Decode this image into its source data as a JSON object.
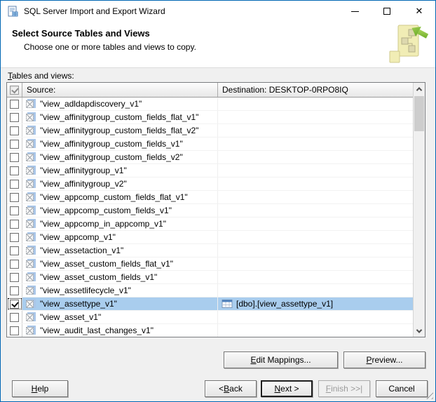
{
  "window": {
    "title": "SQL Server Import and Export Wizard"
  },
  "header": {
    "title": "Select Source Tables and Views",
    "subtitle": "Choose one or more tables and views to copy."
  },
  "tables_label": {
    "label": "Tables and views:",
    "accel": "T"
  },
  "grid": {
    "select_all_state": "mixed",
    "source_header": "Source:",
    "destination_header": "Destination: DESKTOP-0RPO8IQ",
    "rows": [
      {
        "source": "\"view_adldapdiscovery_v1\"",
        "checked": false,
        "selected": false,
        "destination": ""
      },
      {
        "source": "\"view_affinitygroup_custom_fields_flat_v1\"",
        "checked": false,
        "selected": false,
        "destination": ""
      },
      {
        "source": "\"view_affinitygroup_custom_fields_flat_v2\"",
        "checked": false,
        "selected": false,
        "destination": ""
      },
      {
        "source": "\"view_affinitygroup_custom_fields_v1\"",
        "checked": false,
        "selected": false,
        "destination": ""
      },
      {
        "source": "\"view_affinitygroup_custom_fields_v2\"",
        "checked": false,
        "selected": false,
        "destination": ""
      },
      {
        "source": "\"view_affinitygroup_v1\"",
        "checked": false,
        "selected": false,
        "destination": ""
      },
      {
        "source": "\"view_affinitygroup_v2\"",
        "checked": false,
        "selected": false,
        "destination": ""
      },
      {
        "source": "\"view_appcomp_custom_fields_flat_v1\"",
        "checked": false,
        "selected": false,
        "destination": ""
      },
      {
        "source": "\"view_appcomp_custom_fields_v1\"",
        "checked": false,
        "selected": false,
        "destination": ""
      },
      {
        "source": "\"view_appcomp_in_appcomp_v1\"",
        "checked": false,
        "selected": false,
        "destination": ""
      },
      {
        "source": "\"view_appcomp_v1\"",
        "checked": false,
        "selected": false,
        "destination": ""
      },
      {
        "source": "\"view_assetaction_v1\"",
        "checked": false,
        "selected": false,
        "destination": ""
      },
      {
        "source": "\"view_asset_custom_fields_flat_v1\"",
        "checked": false,
        "selected": false,
        "destination": ""
      },
      {
        "source": "\"view_asset_custom_fields_v1\"",
        "checked": false,
        "selected": false,
        "destination": ""
      },
      {
        "source": "\"view_assetlifecycle_v1\"",
        "checked": false,
        "selected": false,
        "destination": ""
      },
      {
        "source": "\"view_assettype_v1\"",
        "checked": true,
        "selected": true,
        "destination": "[dbo].[view_assettype_v1]"
      },
      {
        "source": "\"view_asset_v1\"",
        "checked": false,
        "selected": false,
        "destination": ""
      },
      {
        "source": "\"view_audit_last_changes_v1\"",
        "checked": false,
        "selected": false,
        "destination": ""
      }
    ]
  },
  "buttons": {
    "edit_mappings": {
      "label": "Edit Mappings...",
      "accel": "E"
    },
    "preview": {
      "label": "Preview...",
      "accel": "P"
    },
    "help": {
      "label": "Help",
      "accel": "H"
    },
    "back": {
      "label": "< Back",
      "accel": "B"
    },
    "next": {
      "label": "Next >",
      "accel": "N"
    },
    "finish": {
      "label": "Finish >>|",
      "accel": "F"
    },
    "cancel": {
      "label": "Cancel",
      "accel": ""
    }
  },
  "icons": {
    "close": "✕",
    "view_icon": "view-icon",
    "table_icon": "table-icon",
    "wizard_art": "wizard-tables-art"
  },
  "colors": {
    "selection": "#a9cdee",
    "window_border": "#0066b4"
  }
}
